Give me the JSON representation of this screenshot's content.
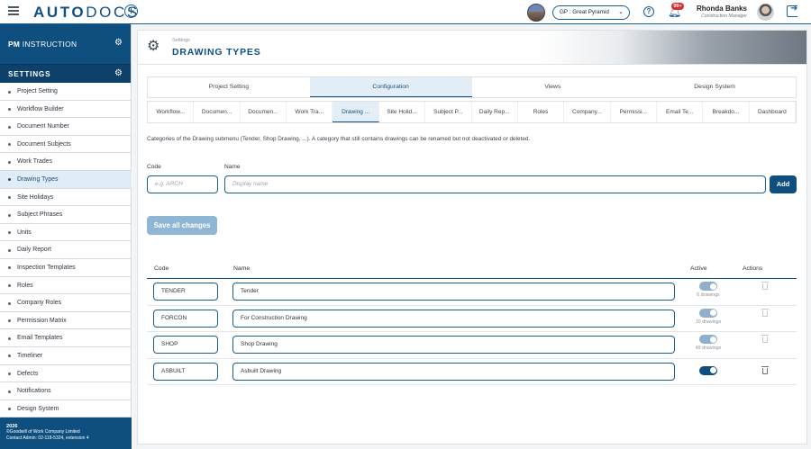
{
  "app": {
    "logo_bold": "AUTO",
    "logo_light": "DOCS"
  },
  "topbar": {
    "project_selector": "GP : Great Pyramid",
    "notification_badge": "99+",
    "user_name": "Rhonda Banks",
    "user_role": "Construction Manager"
  },
  "sidebar": {
    "module_prefix": "PM",
    "module_name": " INSTRUCTION",
    "section_title": "SETTINGS",
    "items": [
      {
        "label": "Project Setting"
      },
      {
        "label": "Workflow Builder"
      },
      {
        "label": "Document Number"
      },
      {
        "label": "Document Subjects"
      },
      {
        "label": "Work Trades"
      },
      {
        "label": "Drawing Types"
      },
      {
        "label": "Site Holidays"
      },
      {
        "label": "Subject Phrases"
      },
      {
        "label": "Units"
      },
      {
        "label": "Daily Report"
      },
      {
        "label": "Inspection Templates"
      },
      {
        "label": "Roles"
      },
      {
        "label": "Company Roles"
      },
      {
        "label": "Permission Matrix"
      },
      {
        "label": "Email Templates"
      },
      {
        "label": "Timeliner"
      },
      {
        "label": "Defects"
      },
      {
        "label": "Notifications"
      },
      {
        "label": "Design System"
      }
    ],
    "active_item": "Drawing Types",
    "footer": {
      "year": "2026",
      "company": "©Goodwill of Work Company Limited",
      "contact": "Contact Admin: 02-118-5324, extension 4"
    }
  },
  "page": {
    "breadcrumb": "Settings",
    "title": "DRAWING TYPES",
    "main_tabs": [
      {
        "label": "Project Setting"
      },
      {
        "label": "Configuration"
      },
      {
        "label": "Views"
      },
      {
        "label": "Design System"
      }
    ],
    "active_main_tab": "Configuration",
    "sub_tabs": [
      {
        "label": "Workflow..."
      },
      {
        "label": "Documen..."
      },
      {
        "label": "Documen..."
      },
      {
        "label": "Work Tra..."
      },
      {
        "label": "Drawing ..."
      },
      {
        "label": "Site Holid..."
      },
      {
        "label": "Subject P..."
      },
      {
        "label": "Daily Rep..."
      },
      {
        "label": "Roles"
      },
      {
        "label": "Company..."
      },
      {
        "label": "Permissi..."
      },
      {
        "label": "Email Te..."
      },
      {
        "label": "Breakdo..."
      },
      {
        "label": "Dashboard"
      }
    ],
    "active_sub_tab": "Drawing ...",
    "description": "Categories of the Drawing submenu (Tender, Shop Drawing, ...). A category that still contains drawings can be renamed but not deactivated or deleted.",
    "form": {
      "code_label": "Code",
      "code_placeholder": "e.g. ARCH",
      "name_label": "Name",
      "name_placeholder": "Display name",
      "add_button": "Add"
    },
    "save_button": "Save all changes",
    "table": {
      "headers": {
        "code": "Code",
        "name": "Name",
        "active": "Active",
        "actions": "Actions"
      },
      "rows": [
        {
          "code": "TENDER",
          "name": "Tender",
          "active": true,
          "drawings": "6 drawings",
          "deletable": false
        },
        {
          "code": "FORCON",
          "name": "For Construction Drawing",
          "active": true,
          "drawings": "10 drawings",
          "deletable": false
        },
        {
          "code": "SHOP",
          "name": "Shop Drawing",
          "active": true,
          "drawings": "49 drawings",
          "deletable": false
        },
        {
          "code": "ASBUILT",
          "name": "Asbuilt Drawing",
          "active": true,
          "drawings": "",
          "deletable": true
        }
      ]
    }
  },
  "colors": {
    "brand": "#0e4f80",
    "accent": "#1b5e92",
    "active_bg": "#e0ecf7",
    "badge": "#d92d2d"
  }
}
